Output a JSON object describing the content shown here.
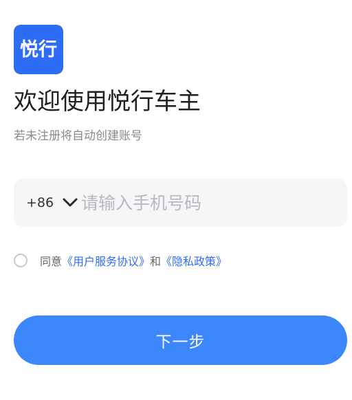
{
  "app": {
    "logo_text": "悦行",
    "brand_color": "#2d6df6"
  },
  "header": {
    "title": "欢迎使用悦行车主",
    "subtitle": "若未注册将自动创建账号"
  },
  "phone": {
    "country_code": "+86",
    "country_icon": "chevron-down-icon",
    "value": "",
    "placeholder": "请输入手机号码"
  },
  "agreement": {
    "checked": false,
    "prefix": "同意",
    "user_agreement": "《用户服务协议》",
    "conjunction": "和",
    "privacy_policy": "《隐私政策》",
    "link_color": "#2d6df6"
  },
  "actions": {
    "next_label": "下一步",
    "button_color": "#3c87fb"
  }
}
